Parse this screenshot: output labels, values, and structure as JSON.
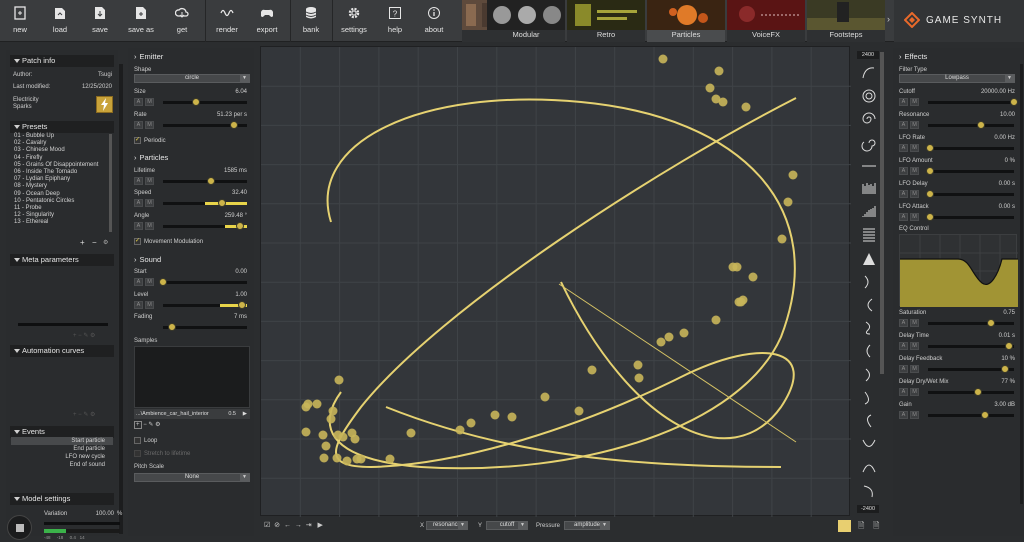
{
  "toolbar": {
    "buttons": [
      {
        "id": "new",
        "label": "new"
      },
      {
        "id": "load",
        "label": "load"
      },
      {
        "id": "save",
        "label": "save"
      },
      {
        "id": "save-as",
        "label": "save as"
      },
      {
        "id": "get",
        "label": "get"
      },
      {
        "id": "render",
        "label": "render"
      },
      {
        "id": "export",
        "label": "export"
      },
      {
        "id": "bank",
        "label": "bank"
      },
      {
        "id": "settings",
        "label": "settings"
      },
      {
        "id": "help",
        "label": "help"
      },
      {
        "id": "about",
        "label": "about"
      }
    ],
    "modes": [
      "Modular",
      "Retro",
      "Particles",
      "VoiceFX",
      "Footsteps"
    ],
    "selected_mode": "Particles",
    "brand": "GAME SYNTH"
  },
  "patch_info": {
    "title": "Patch info",
    "author_label": "Author:",
    "author": "Tsugi",
    "modified_label": "Last modified:",
    "modified": "12/25/2020",
    "patch_name_line1": "Electricity",
    "patch_name_line2": "Sparks"
  },
  "presets": {
    "title": "Presets",
    "items": [
      "01 - Bubble Up",
      "02 - Cavalry",
      "03 - Chinese Mood",
      "04 - Firefly",
      "05 - Grains Of Disappointement",
      "06 - Inside The Tornado",
      "07 - Lydian Epiphany",
      "08 - Mystery",
      "09 - Ocean Deep",
      "10 - Pentatonic Circles",
      "11 - Probe",
      "12 - Singularity",
      "13 - Ethereal"
    ]
  },
  "meta_parameters": {
    "title": "Meta parameters"
  },
  "automation_curves": {
    "title": "Automation curves"
  },
  "events": {
    "title": "Events",
    "items": [
      "Start particle",
      "End particle",
      "LFO new cycle",
      "End of sound"
    ]
  },
  "model_settings": {
    "title": "Model settings",
    "variation_label": "Variation",
    "variation_value": "100.00",
    "variation_unit": "%",
    "meter_ticks": [
      "-48",
      "-18",
      "0.4",
      "14"
    ]
  },
  "emitter": {
    "title": "Emitter",
    "shape_label": "Shape",
    "shape_value": "circle",
    "size_label": "Size",
    "size_value": "6.04",
    "rate_label": "Rate",
    "rate_value": "51.23 per s",
    "periodic_label": "Periodic"
  },
  "particles": {
    "title": "Particles",
    "lifetime_label": "Lifetime",
    "lifetime_value": "1585 ms",
    "speed_label": "Speed",
    "speed_value": "32.40",
    "angle_label": "Angle",
    "angle_value": "259.48 °",
    "movement_label": "Movement Modulation"
  },
  "sound": {
    "title": "Sound",
    "start_label": "Start",
    "start_value": "0.00",
    "level_label": "Level",
    "level_value": "1.00",
    "fading_label": "Fading",
    "fading_value": "7 ms",
    "samples_label": "Samples",
    "sample_file": "...\\Ambience_car_hail_interior",
    "sample_value": "0.5",
    "loop_label": "Loop",
    "stretch_label": "Stretch to lifetime",
    "pitch_label": "Pitch Scale",
    "pitch_value": "None"
  },
  "canvas": {
    "top_value": "2400",
    "bottom_value": "-2400"
  },
  "bottom_bar": {
    "x_label": "X",
    "x_value": "resonance",
    "y_label": "Y",
    "y_value": "cutoff",
    "pressure_label": "Pressure",
    "pressure_value": "amplitude"
  },
  "effects": {
    "title": "Effects",
    "filter_type_label": "Filter Type",
    "filter_type_value": "Lowpass",
    "cutoff_label": "Cutoff",
    "cutoff_value": "20000.00 Hz",
    "resonance_label": "Resonance",
    "resonance_value": "10.00",
    "lfo_rate_label": "LFO Rate",
    "lfo_rate_value": "0.00 Hz",
    "lfo_amount_label": "LFO Amount",
    "lfo_amount_value": "0 %",
    "lfo_delay_label": "LFO Delay",
    "lfo_delay_value": "0.00 s",
    "lfo_attack_label": "LFO Attack",
    "lfo_attack_value": "0.00 s",
    "eq_label": "EQ Control",
    "saturation_label": "Saturation",
    "saturation_value": "0.75",
    "delay_time_label": "Delay Time",
    "delay_time_value": "0.01 s",
    "delay_feedback_label": "Delay Feedback",
    "delay_feedback_value": "10 %",
    "delay_mix_label": "Delay Dry/Wet Mix",
    "delay_mix_value": "77 %",
    "gain_label": "Gain",
    "gain_value": "3.00 dB"
  }
}
